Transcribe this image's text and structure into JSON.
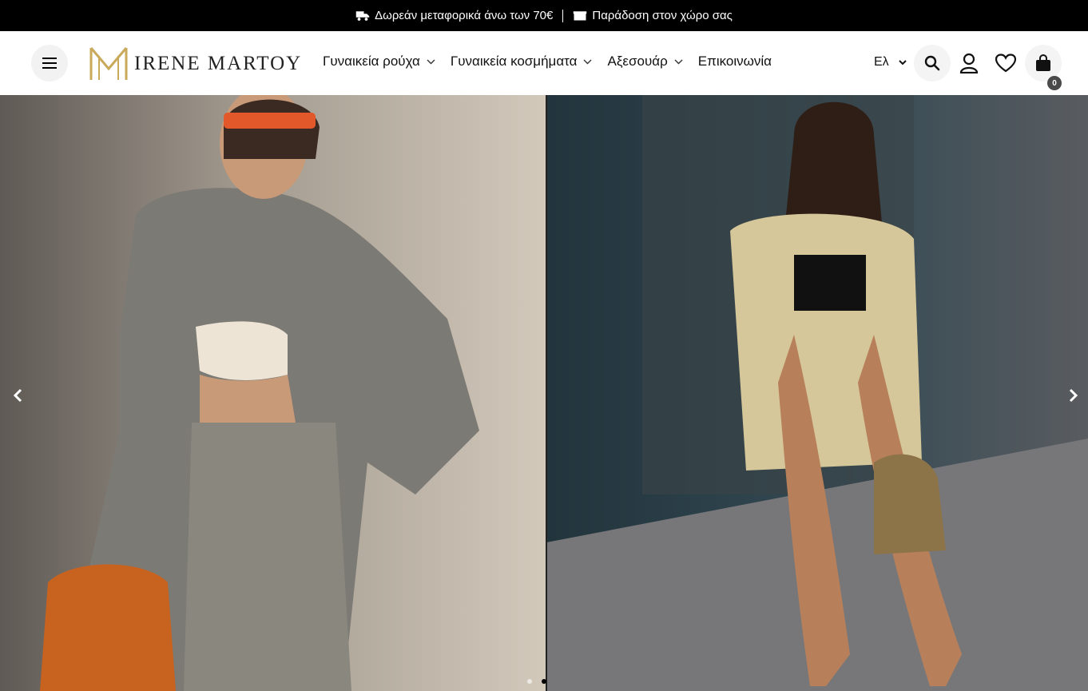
{
  "announcement": {
    "shipping": "Δωρεάν μεταφορικά άνω των 70€",
    "delivery": "Παράδοση στον χώρο σας"
  },
  "brand": {
    "name": "IRENE MARTOY",
    "gold": "#c9a95a"
  },
  "nav": {
    "items": [
      {
        "label": "Γυναικεία ρούχα",
        "has_dropdown": true
      },
      {
        "label": "Γυναικεία κοσμήματα",
        "has_dropdown": true
      },
      {
        "label": "Αξεσουάρ",
        "has_dropdown": true
      },
      {
        "label": "Επικοινωνία",
        "has_dropdown": false
      }
    ]
  },
  "header": {
    "language": "Ελ",
    "cart_count": "0",
    "icons": [
      "menu-icon",
      "search-icon",
      "user-icon",
      "heart-icon",
      "bag-icon"
    ]
  },
  "hero": {
    "slides": [
      {
        "description": "woman in grey plaid blazer and skirt with orange bag"
      },
      {
        "description": "woman in checked blazer and shorts walking on street"
      }
    ],
    "active_dot": 1,
    "dot_count": 2
  },
  "colors": {
    "topbar_bg": "#000000",
    "text": "#111111",
    "icon_bg": "#f4f4f4"
  }
}
